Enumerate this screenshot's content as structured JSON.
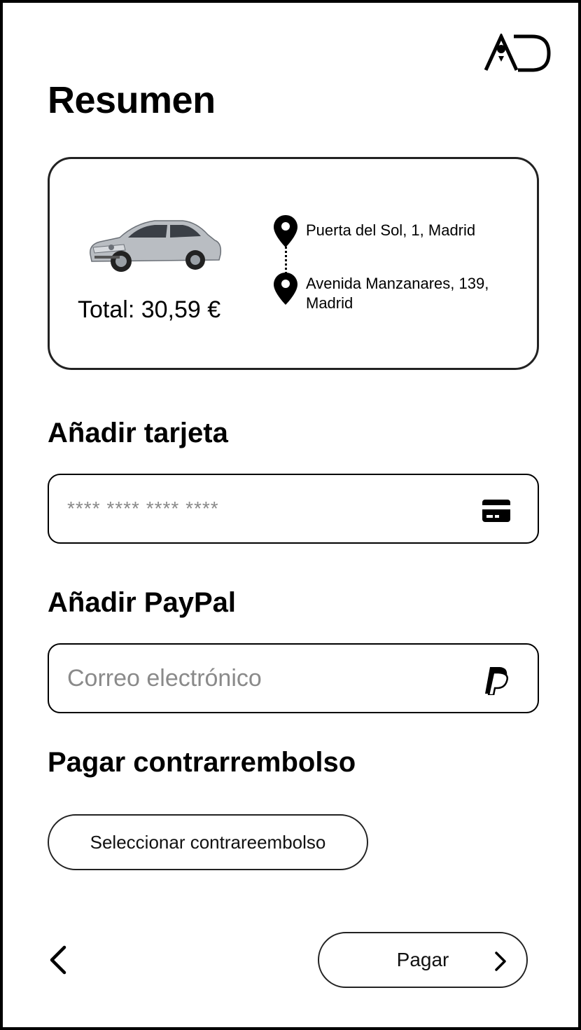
{
  "header": {
    "logo_text": "AD",
    "title": "Resumen"
  },
  "summary": {
    "total_label": "Total: 30,59 €",
    "origin": "Puerta del Sol, 1, Madrid",
    "destination": "Avenida Manzanares, 139, Madrid"
  },
  "card_section": {
    "title": "Añadir tarjeta",
    "placeholder": "**** **** **** ****",
    "icon": "credit-card-icon"
  },
  "paypal_section": {
    "title": "Añadir PayPal",
    "placeholder": "Correo electrónico",
    "icon": "paypal-icon"
  },
  "cod_section": {
    "title": "Pagar contrarrembolso",
    "button_label": "Seleccionar contrareembolso"
  },
  "footer": {
    "back_icon": "chevron-left-icon",
    "pay_label": "Pagar",
    "pay_icon": "chevron-right-icon"
  },
  "colors": {
    "border": "#222222",
    "placeholder": "#8a8a8a",
    "background": "#ffffff",
    "text": "#000000"
  }
}
